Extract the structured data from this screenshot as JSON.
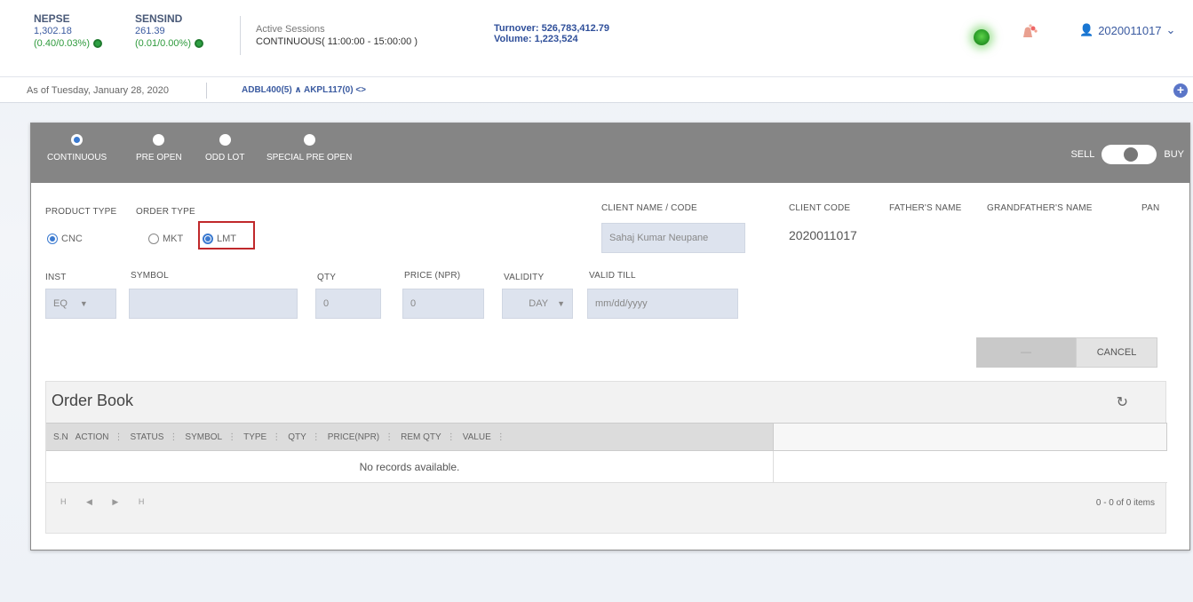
{
  "header": {
    "indices": [
      {
        "name": "NEPSE",
        "value": "1,302.18",
        "change": "(0.40/0.03%)"
      },
      {
        "name": "SENSIND",
        "value": "261.39",
        "change": "(0.01/0.00%)"
      }
    ],
    "sessions_label": "Active Sessions",
    "sessions_value": "CONTINUOUS( 11:00:00 - 15:00:00 )",
    "turnover": "Turnover: 526,783,412.79",
    "volume": "Volume: 1,223,524",
    "user": "2020011017",
    "colors": {
      "status_led": "#2ea12a",
      "accent": "#3a5aa0",
      "change_green": "#2e9a3c"
    }
  },
  "subbar": {
    "as_of": "As of Tuesday, January 28, 2020",
    "ticker": "ADBL400(5)  ∧  AKPL117(0)  <>"
  },
  "panel": {
    "markets": [
      {
        "label": "CONTINUOUS",
        "selected": true
      },
      {
        "label": "PRE OPEN",
        "selected": false
      },
      {
        "label": "ODD LOT",
        "selected": false
      },
      {
        "label": "SPECIAL PRE OPEN",
        "selected": false
      }
    ],
    "sell_label": "SELL",
    "buy_label": "BUY",
    "product_type_label": "PRODUCT TYPE",
    "order_type_label": "ORDER TYPE",
    "product_cnc": "CNC",
    "order_mkt": "MKT",
    "order_lmt": "LMT",
    "client_name_label": "CLIENT NAME / CODE",
    "client_name_value": "Sahaj Kumar Neupane",
    "client_code_label": "CLIENT CODE",
    "client_code_value": "2020011017",
    "fathers_name_label": "FATHER'S NAME",
    "grandfathers_name_label": "GRANDFATHER'S NAME",
    "pan_label": "PAN",
    "inst_label": "INST",
    "inst_value": "EQ",
    "symbol_label": "SYMBOL",
    "qty_label": "QTY",
    "qty_value": "0",
    "price_label": "PRICE (NPR)",
    "price_value": "0",
    "validity_label": "VALIDITY",
    "validity_value": "DAY",
    "valid_till_label": "VALID TILL",
    "valid_till_placeholder": "mm/dd/yyyy",
    "cancel_label": "CANCEL",
    "submit_label": "—"
  },
  "order_book": {
    "title": "Order Book",
    "columns": [
      "S.N",
      "ACTION",
      "STATUS",
      "SYMBOL",
      "TYPE",
      "QTY",
      "PRICE(NPR)",
      "REM QTY",
      "VALUE"
    ],
    "empty_text": "No records available.",
    "pager": "H  ◀  ▶  H",
    "items_text": "0 - 0 of 0 items"
  }
}
